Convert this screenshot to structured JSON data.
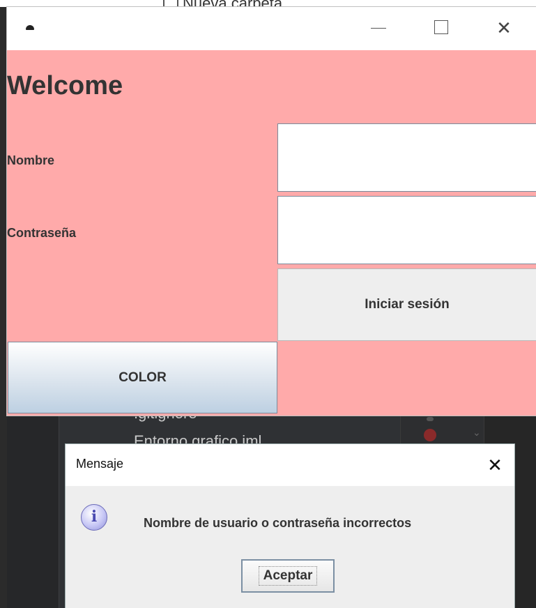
{
  "background": {
    "top_text": "Nueva carpeta",
    "lines": [
      ".gitignore",
      "Entorno grafico.iml"
    ]
  },
  "window": {
    "min_icon": "minimize-icon",
    "max_icon": "maximize-icon",
    "close_symbol": "✕",
    "background_color": "#ffaaaa"
  },
  "form": {
    "welcome": "Welcome",
    "name_label": "Nombre",
    "password_label": "Contraseña",
    "name_value": "",
    "password_value": "",
    "login_button": "Iniciar sesión",
    "color_button": "COLOR"
  },
  "dialog": {
    "title": "Mensaje",
    "close_symbol": "✕",
    "icon": "info-icon",
    "icon_glyph": "i",
    "message": "Nombre de usuario o contraseña incorrectos",
    "ok_button": "Aceptar"
  }
}
